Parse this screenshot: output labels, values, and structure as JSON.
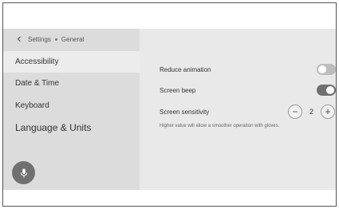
{
  "breadcrumb": {
    "parent": "Settings",
    "current": "General",
    "back_icon": "chevron-left-icon"
  },
  "sidebar": {
    "items": [
      {
        "label": "Accessibility",
        "selected": true
      },
      {
        "label": "Date & Time",
        "selected": false
      },
      {
        "label": "Keyboard",
        "selected": false
      },
      {
        "label": "Language & Units",
        "selected": false
      }
    ],
    "mic_icon": "microphone-icon"
  },
  "settings": {
    "reduce_animation": {
      "label": "Reduce animation",
      "enabled": false
    },
    "screen_beep": {
      "label": "Screen beep",
      "enabled": true
    },
    "screen_sensitivity": {
      "label": "Screen sensitivity",
      "value": "2",
      "decrement": "−",
      "increment": "+",
      "hint": "Higher value will allow a smoother operation with gloves."
    }
  },
  "colors": {
    "sidebar_bg": "#dcdcdc",
    "content_bg": "#e9e9e9",
    "selected_bg": "#ececec",
    "toggle_on": "#707070",
    "toggle_off": "#bdbdbd"
  }
}
